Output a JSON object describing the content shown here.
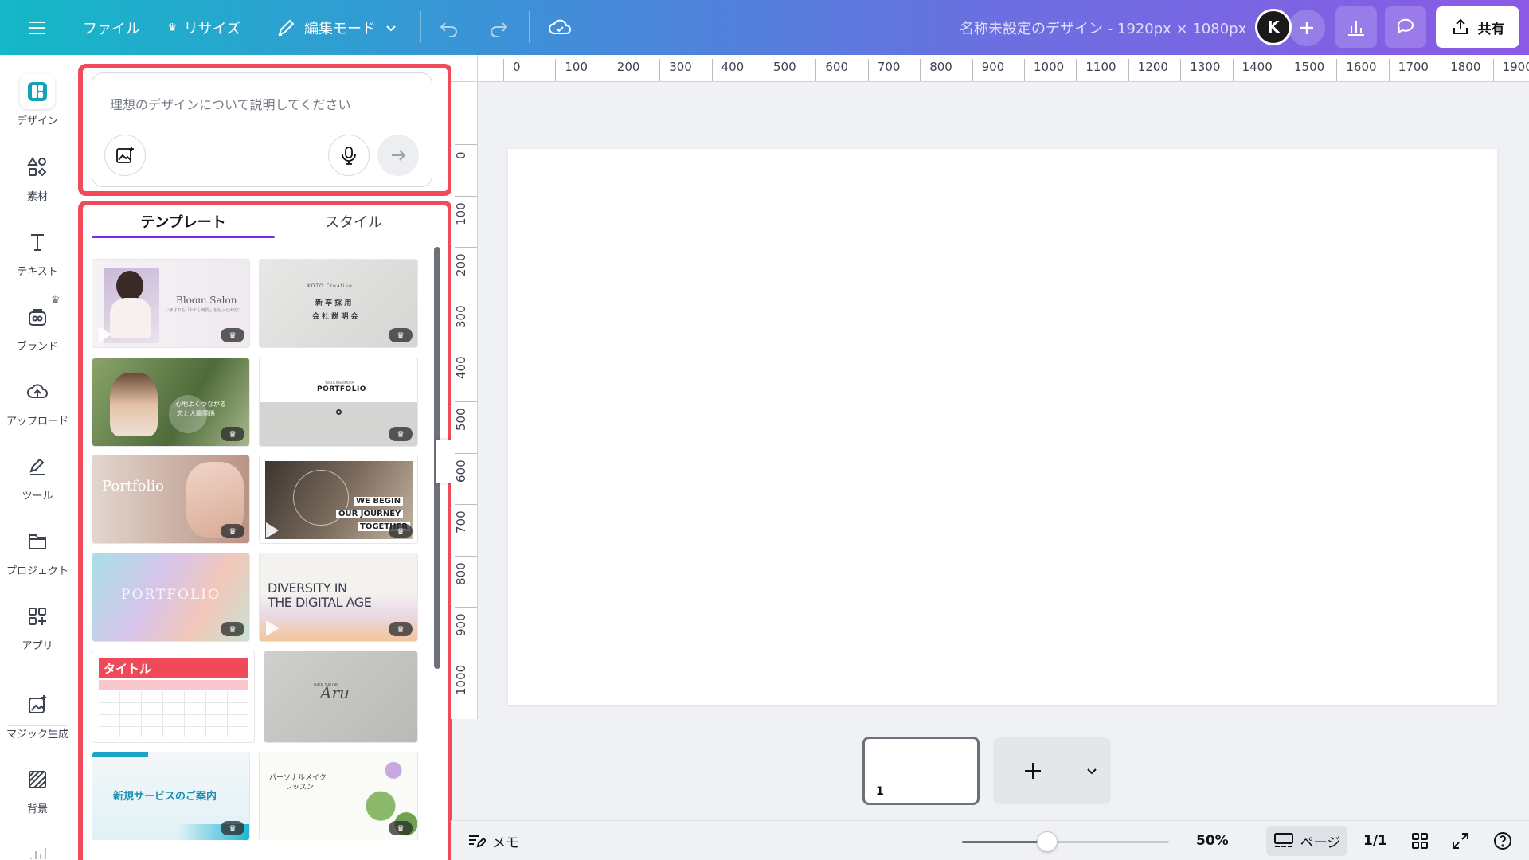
{
  "topbar": {
    "file_label": "ファイル",
    "resize_label": "リサイズ",
    "edit_mode_label": "編集モード",
    "doc_title": "名称未設定のデザイン - 1920px × 1080px",
    "share_label": "共有",
    "avatar_initial": "K"
  },
  "rail": {
    "items": [
      {
        "label": "デザイン",
        "icon": "design-icon"
      },
      {
        "label": "素材",
        "icon": "elements-icon"
      },
      {
        "label": "テキスト",
        "icon": "text-icon"
      },
      {
        "label": "ブランド",
        "icon": "brand-icon"
      },
      {
        "label": "アップロード",
        "icon": "upload-icon"
      },
      {
        "label": "ツール",
        "icon": "tools-icon"
      },
      {
        "label": "プロジェクト",
        "icon": "projects-icon"
      },
      {
        "label": "アプリ",
        "icon": "apps-icon"
      },
      {
        "label": "マジック生成",
        "icon": "magic-media-icon"
      },
      {
        "label": "背景",
        "icon": "background-icon"
      }
    ]
  },
  "panel": {
    "prompt_placeholder": "理想のデザインについて説明してください",
    "tabs": [
      "テンプレート",
      "スタイル"
    ],
    "templates": [
      {
        "title": "Bloom Salon",
        "sub": "いまよりも「わたし時間」をもっと大切に"
      },
      {
        "brand": "KOTO Creative",
        "line1": "新 卒 採 用",
        "line2": "会 社 説 明 会"
      },
      {
        "line1": "心地よくつながる",
        "line2": "恋と人間関係"
      },
      {
        "small": "YUKTA NISHIMURA",
        "title": "PORTFOLIO"
      },
      {
        "title": "Portfolio"
      },
      {
        "line1": "WE BEGIN",
        "line2": "OUR JOURNEY",
        "line3": "TOGETHER"
      },
      {
        "title": "PORTFOLIO"
      },
      {
        "line1": "DIVERSITY IN",
        "line2": "THE DIGITAL AGE"
      },
      {
        "title": "タイトル"
      },
      {
        "small": "HAIR SALON",
        "script": "Aru"
      },
      {
        "title": "新規サービスのご案内"
      },
      {
        "line1": "パーソナルメイク",
        "line2": "レッスン"
      }
    ]
  },
  "ruler": {
    "top": [
      "0",
      "100",
      "200",
      "300",
      "400",
      "500",
      "600",
      "700",
      "800",
      "900",
      "1000",
      "1100",
      "1200",
      "1300",
      "1400",
      "1500",
      "1600",
      "1700",
      "1800",
      "1900"
    ],
    "left": [
      "0",
      "100",
      "200",
      "300",
      "400",
      "500",
      "600",
      "700",
      "800",
      "900",
      "1000"
    ]
  },
  "pages": {
    "current_page_number": "1"
  },
  "bottombar": {
    "notes_label": "メモ",
    "zoom_percent": 50,
    "zoom_label": "50%",
    "page_view_label": "ページ",
    "page_counter": "1/1"
  },
  "colors": {
    "accent": "#7d2ae8",
    "highlight": "#ef4b5a"
  }
}
